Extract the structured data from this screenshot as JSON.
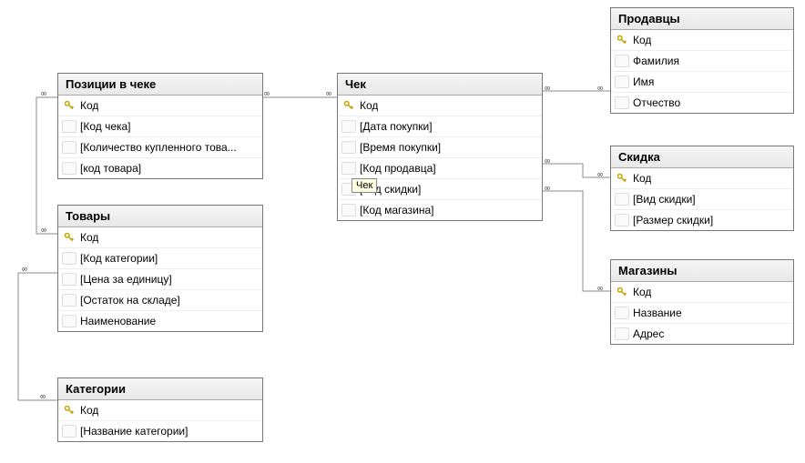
{
  "tables": {
    "positions": {
      "title": "Позиции в чеке",
      "fields": [
        {
          "key": true,
          "label": "Код"
        },
        {
          "key": false,
          "label": "[Код чека]"
        },
        {
          "key": false,
          "label": "[Количество купленного това..."
        },
        {
          "key": false,
          "label": "[код товара]"
        }
      ]
    },
    "goods": {
      "title": "Товары",
      "fields": [
        {
          "key": true,
          "label": "Код"
        },
        {
          "key": false,
          "label": "[Код категории]"
        },
        {
          "key": false,
          "label": "[Цена за единицу]"
        },
        {
          "key": false,
          "label": "[Остаток на складе]"
        },
        {
          "key": false,
          "label": "Наименование"
        }
      ]
    },
    "categories": {
      "title": "Категории",
      "fields": [
        {
          "key": true,
          "label": "Код"
        },
        {
          "key": false,
          "label": "[Название категории]"
        }
      ]
    },
    "check": {
      "title": "Чек",
      "fields": [
        {
          "key": true,
          "label": "Код"
        },
        {
          "key": false,
          "label": "[Дата покупки]"
        },
        {
          "key": false,
          "label": "[Время покупки]"
        },
        {
          "key": false,
          "label": "[Код продавца]"
        },
        {
          "key": false,
          "label": "[Код скидки]"
        },
        {
          "key": false,
          "label": "[Код магазина]"
        }
      ]
    },
    "sellers": {
      "title": "Продавцы",
      "fields": [
        {
          "key": true,
          "label": "Код"
        },
        {
          "key": false,
          "label": "Фамилия"
        },
        {
          "key": false,
          "label": "Имя"
        },
        {
          "key": false,
          "label": "Отчество"
        }
      ]
    },
    "discount": {
      "title": "Скидка",
      "fields": [
        {
          "key": true,
          "label": "Код"
        },
        {
          "key": false,
          "label": "[Вид скидки]"
        },
        {
          "key": false,
          "label": "[Размер скидки]"
        }
      ]
    },
    "stores": {
      "title": "Магазины",
      "fields": [
        {
          "key": true,
          "label": "Код"
        },
        {
          "key": false,
          "label": "Название"
        },
        {
          "key": false,
          "label": "Адрес"
        }
      ]
    }
  },
  "tooltip": "Чек",
  "relations": [
    {
      "from": "positions",
      "to": "check"
    },
    {
      "from": "positions",
      "to": "goods"
    },
    {
      "from": "goods",
      "to": "categories"
    },
    {
      "from": "check",
      "to": "sellers"
    },
    {
      "from": "check",
      "to": "discount"
    },
    {
      "from": "check",
      "to": "stores"
    }
  ]
}
